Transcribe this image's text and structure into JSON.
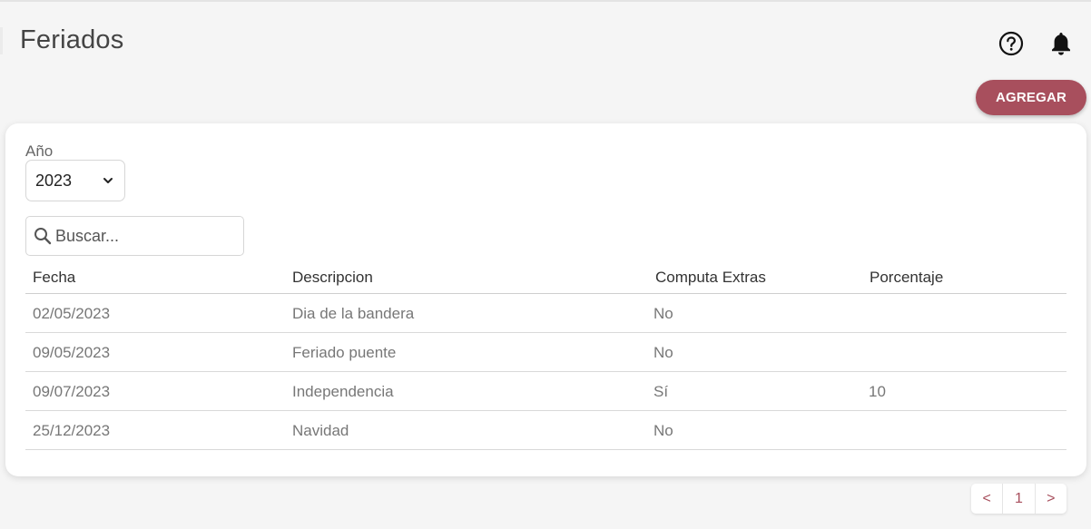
{
  "header": {
    "title": "Feriados",
    "add_button": "AGREGAR"
  },
  "filters": {
    "year_label": "Año",
    "year_value": "2023",
    "search_placeholder": "Buscar..."
  },
  "table": {
    "columns": [
      "Fecha",
      "Descripcion",
      "Computa Extras",
      "Porcentaje"
    ],
    "rows": [
      [
        "02/05/2023",
        "Dia de la bandera",
        "No",
        ""
      ],
      [
        "09/05/2023",
        "Feriado puente",
        "No",
        ""
      ],
      [
        "09/07/2023",
        "Independencia",
        "Sí",
        "10"
      ],
      [
        "25/12/2023",
        "Navidad",
        "No",
        ""
      ]
    ]
  },
  "pagination": {
    "prev": "<",
    "current": "1",
    "next": ">"
  },
  "colors": {
    "accent": "#a84f5d",
    "background": "#f5f5f5"
  },
  "icons": [
    "help-icon",
    "bell-icon",
    "chevron-down-icon",
    "search-icon"
  ]
}
